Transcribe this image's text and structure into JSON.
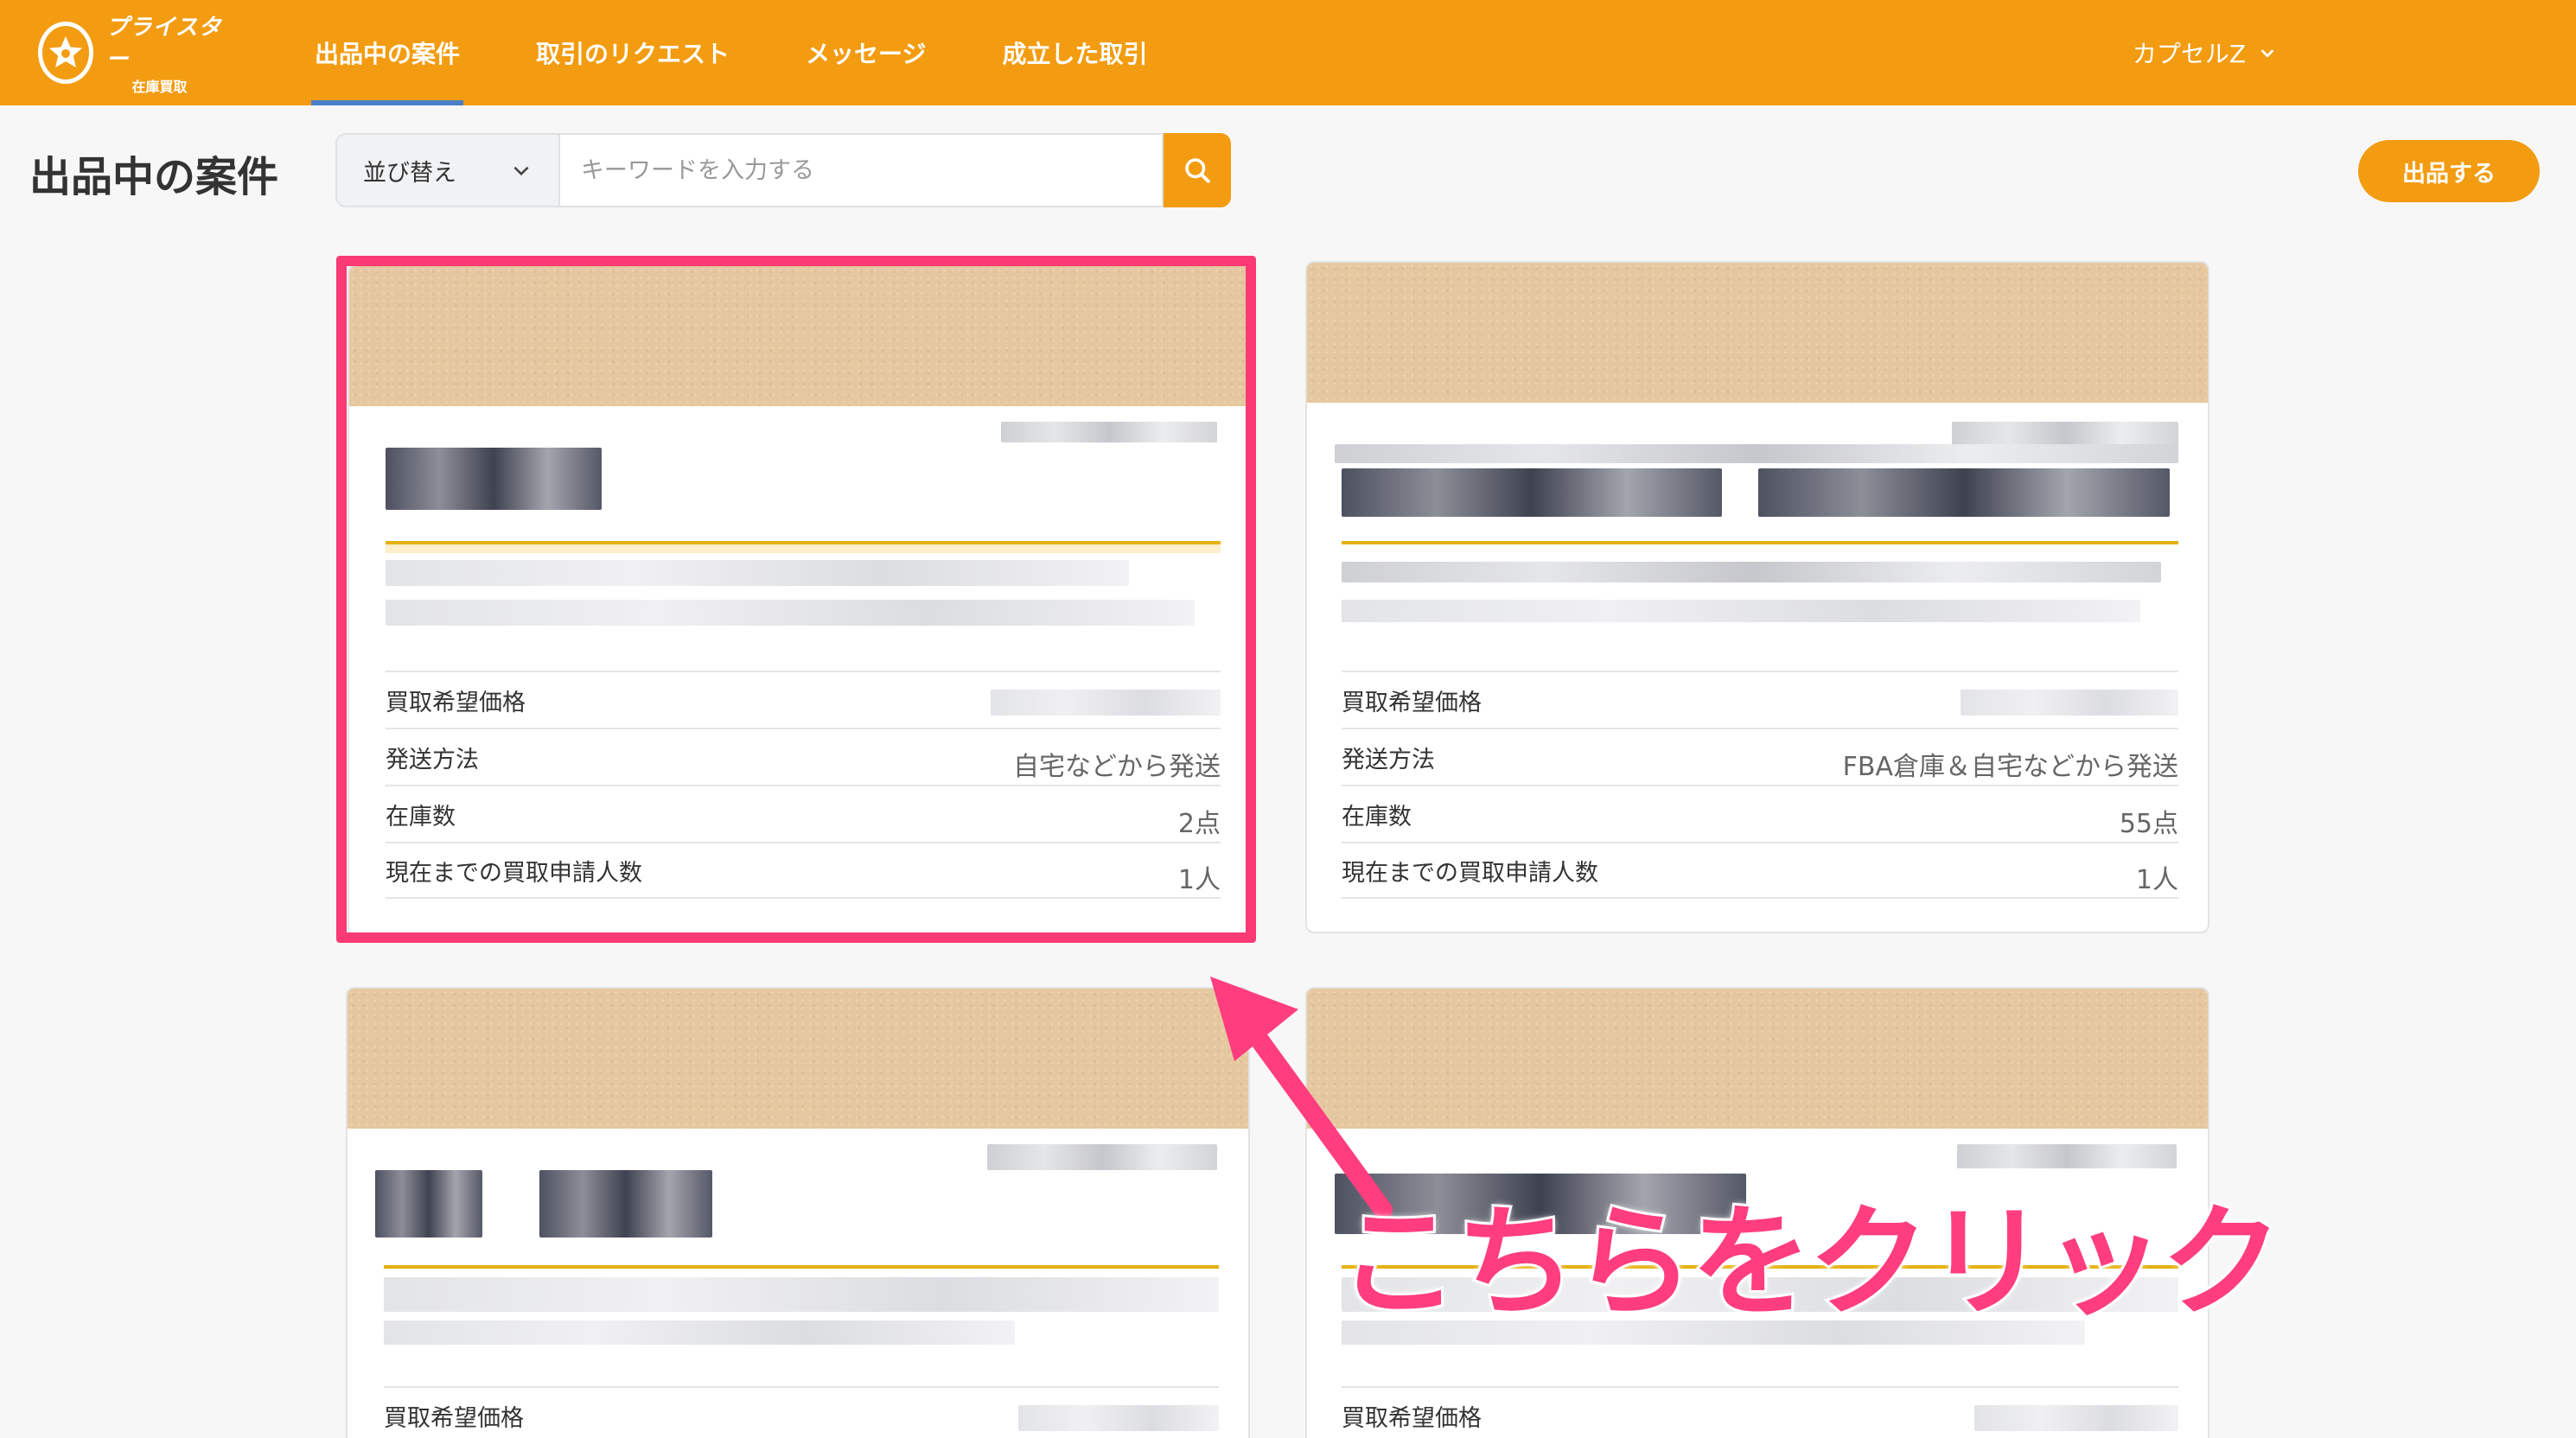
{
  "header": {
    "logo_main": "プライスター",
    "logo_sub": "在庫買取",
    "nav": [
      {
        "label": "出品中の案件",
        "active": true
      },
      {
        "label": "取引のリクエスト"
      },
      {
        "label": "メッセージ"
      },
      {
        "label": "成立した取引"
      }
    ],
    "user_name": "カプセルZ"
  },
  "toolbar": {
    "page_title": "出品中の案件",
    "sort_label": "並び替え",
    "search_placeholder": "キーワードを入力する",
    "list_button": "出品する"
  },
  "cards": [
    {
      "rows": [
        {
          "label": "買取希望価格",
          "value": ""
        },
        {
          "label": "発送方法",
          "value": "自宅などから発送"
        },
        {
          "label": "在庫数",
          "value": "2点"
        },
        {
          "label": "現在までの買取申請人数",
          "value": "1人"
        }
      ]
    },
    {
      "rows": [
        {
          "label": "買取希望価格",
          "value": ""
        },
        {
          "label": "発送方法",
          "value": "FBA倉庫＆自宅などから発送"
        },
        {
          "label": "在庫数",
          "value": "55点"
        },
        {
          "label": "現在までの買取申請人数",
          "value": "1人"
        }
      ]
    },
    {
      "rows": [
        {
          "label": "買取希望価格",
          "value": ""
        }
      ]
    },
    {
      "rows": [
        {
          "label": "買取希望価格",
          "value": ""
        }
      ]
    }
  ],
  "annotation": "こちらをクリック",
  "colors": {
    "brand": "#f39c11",
    "highlight": "#fa3a75",
    "nav_active_underline": "#4a7fc8"
  }
}
